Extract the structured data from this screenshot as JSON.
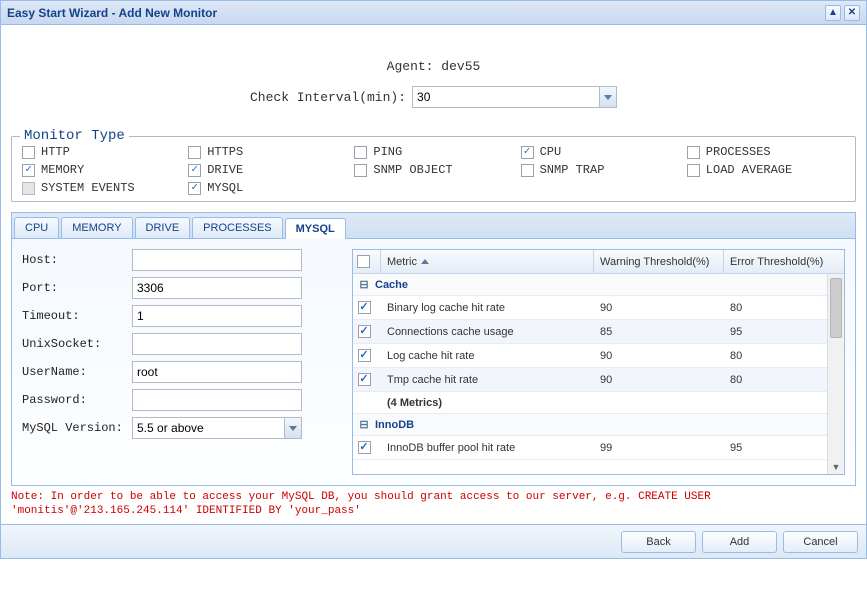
{
  "title": "Easy Start Wizard - Add New Monitor",
  "top": {
    "agent_label": "Agent:",
    "agent_value": "dev55",
    "interval_label": "Check Interval(min):",
    "interval_value": "30"
  },
  "monitor_type": {
    "legend": "Monitor Type",
    "items": [
      {
        "label": "HTTP",
        "checked": false
      },
      {
        "label": "HTTPS",
        "checked": false
      },
      {
        "label": "PING",
        "checked": false
      },
      {
        "label": "CPU",
        "checked": true
      },
      {
        "label": "PROCESSES",
        "checked": false
      },
      {
        "label": "MEMORY",
        "checked": true
      },
      {
        "label": "DRIVE",
        "checked": true
      },
      {
        "label": "SNMP OBJECT",
        "checked": false
      },
      {
        "label": "SNMP TRAP",
        "checked": false
      },
      {
        "label": "LOAD AVERAGE",
        "checked": false
      },
      {
        "label": "SYSTEM EVENTS",
        "checked": false,
        "disabled": true
      },
      {
        "label": "MYSQL",
        "checked": true
      }
    ]
  },
  "tabs": [
    "CPU",
    "MEMORY",
    "DRIVE",
    "PROCESSES",
    "MYSQL"
  ],
  "active_tab": "MYSQL",
  "mysql_form": {
    "host_label": "Host:",
    "host_value": "",
    "port_label": "Port:",
    "port_value": "3306",
    "timeout_label": "Timeout:",
    "timeout_value": "1",
    "unixsocket_label": "UnixSocket:",
    "unixsocket_value": "",
    "username_label": "UserName:",
    "username_value": "root",
    "password_label": "Password:",
    "password_value": "",
    "version_label": "MySQL Version:",
    "version_value": "5.5 or above"
  },
  "grid": {
    "headers": {
      "metric": "Metric",
      "warn": "Warning Threshold(%)",
      "err": "Error Threshold(%)"
    },
    "groups": [
      {
        "name": "Cache",
        "rows": [
          {
            "metric": "Binary log cache hit rate",
            "warn": "90",
            "err": "80",
            "checked": true
          },
          {
            "metric": "Connections cache usage",
            "warn": "85",
            "err": "95",
            "checked": true
          },
          {
            "metric": "Log cache hit rate",
            "warn": "90",
            "err": "80",
            "checked": true
          },
          {
            "metric": "Tmp cache hit rate",
            "warn": "90",
            "err": "80",
            "checked": true
          }
        ],
        "summary": "(4 Metrics)"
      },
      {
        "name": "InnoDB",
        "rows": [
          {
            "metric": "InnoDB buffer pool hit rate",
            "warn": "99",
            "err": "95",
            "checked": true
          }
        ]
      }
    ]
  },
  "note": "Note: In order to be able to access your MySQL DB, you should grant access to our server, e.g. CREATE USER 'monitis'@'213.165.245.114' IDENTIFIED BY 'your_pass'",
  "buttons": {
    "back": "Back",
    "add": "Add",
    "cancel": "Cancel"
  }
}
